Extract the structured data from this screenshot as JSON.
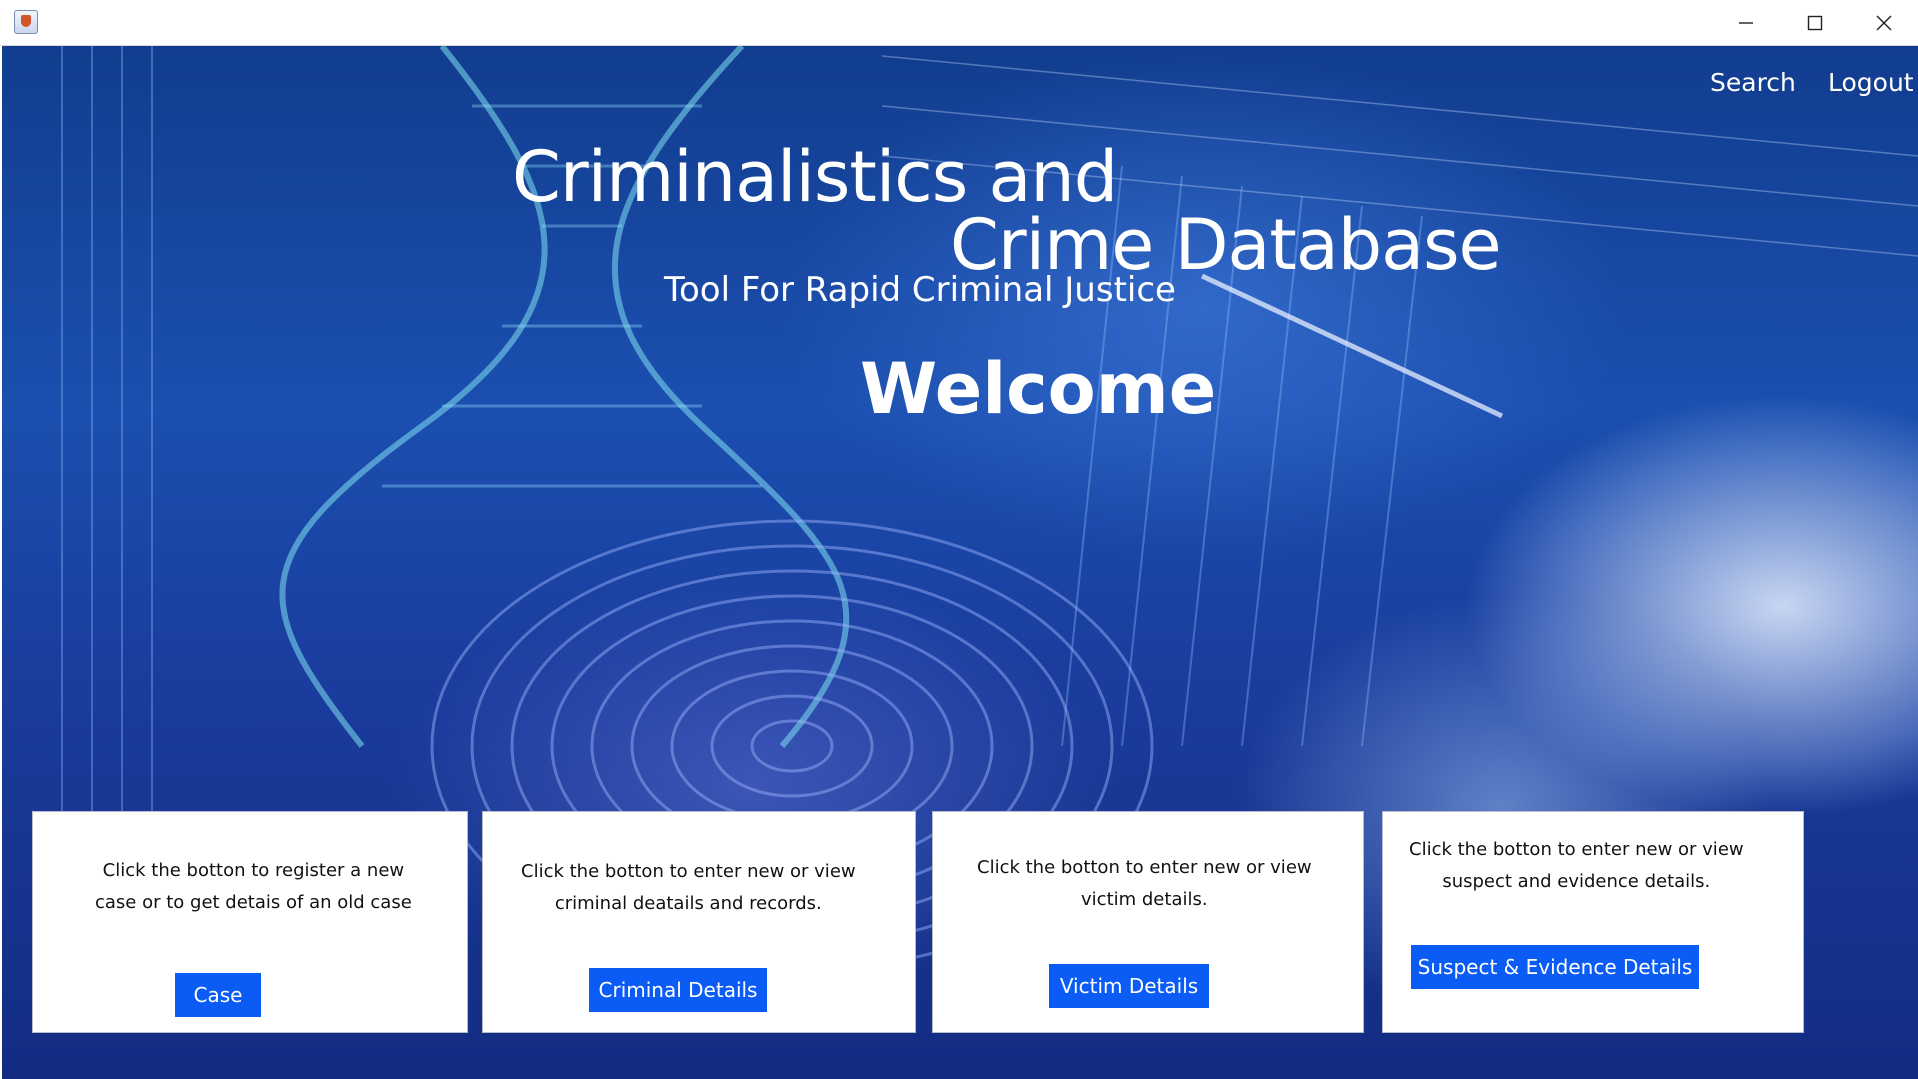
{
  "window": {
    "icon": "java-coffee-cup-icon",
    "controls": [
      "minimize-icon",
      "maximize-icon",
      "close-icon"
    ]
  },
  "nav": {
    "search": "Search",
    "logout": "Logout"
  },
  "header": {
    "title_line1": "Criminalistics and",
    "title_line2": "Crime Database",
    "subtitle": "Tool For Rapid Criminal Justice",
    "welcome": "Welcome"
  },
  "cards": [
    {
      "line1": "Click the botton to register a new",
      "line2": "case or to get detais of an old case",
      "button": "Case"
    },
    {
      "line1": "Click the botton to enter new or view",
      "line2": "criminal deatails and records.",
      "button": "Criminal Details"
    },
    {
      "line1": "Click the botton to enter new or view",
      "line2": "victim details.",
      "button": "Victim Details"
    },
    {
      "line1": "Click the botton to enter new or view",
      "line2": "suspect and evidence details.",
      "button": "Suspect & Evidence Details"
    }
  ],
  "colors": {
    "button_bg": "#0a5cf5",
    "background_blue": "#1b4fb0"
  }
}
